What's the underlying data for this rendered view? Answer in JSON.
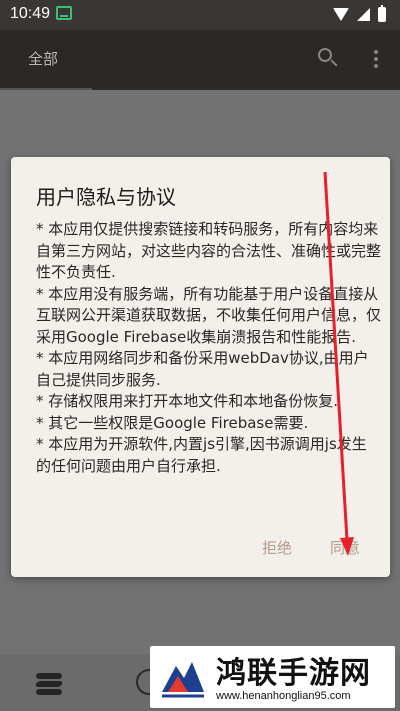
{
  "status_bar": {
    "time": "10:49"
  },
  "app_bar": {
    "tab_all": "全部"
  },
  "dialog": {
    "title": "用户隐私与协议",
    "paragraphs": [
      "* 本应用仅提供搜索链接和转码服务，所有内容均来自第三方网站，对这些内容的合法性、准确性或完整性不负责任.",
      "* 本应用没有服务端，所有功能基于用户设备直接从互联网公开渠道获取数据，不收集任何用户信息，仅采用Google Firebase收集崩溃报告和性能报告.",
      "* 本应用网络同步和备份采用webDav协议,由用户自己提供同步服务.",
      "* 存储权限用来打开本地文件和本地备份恢复.",
      "* 其它一些权限是Google Firebase需要.",
      "* 本应用为开源软件,内置js引擎,因书源调用js发生的任何问题由用户自行承担."
    ],
    "reject_label": "拒绝",
    "agree_label": "同意"
  },
  "watermark": {
    "title": "鸿联手游网",
    "url": "www.henanhonglian95.com"
  },
  "colors": {
    "dialog_bg": "#f3efea",
    "action_text": "#b49a8a",
    "annotation_arrow": "#e8202a"
  }
}
